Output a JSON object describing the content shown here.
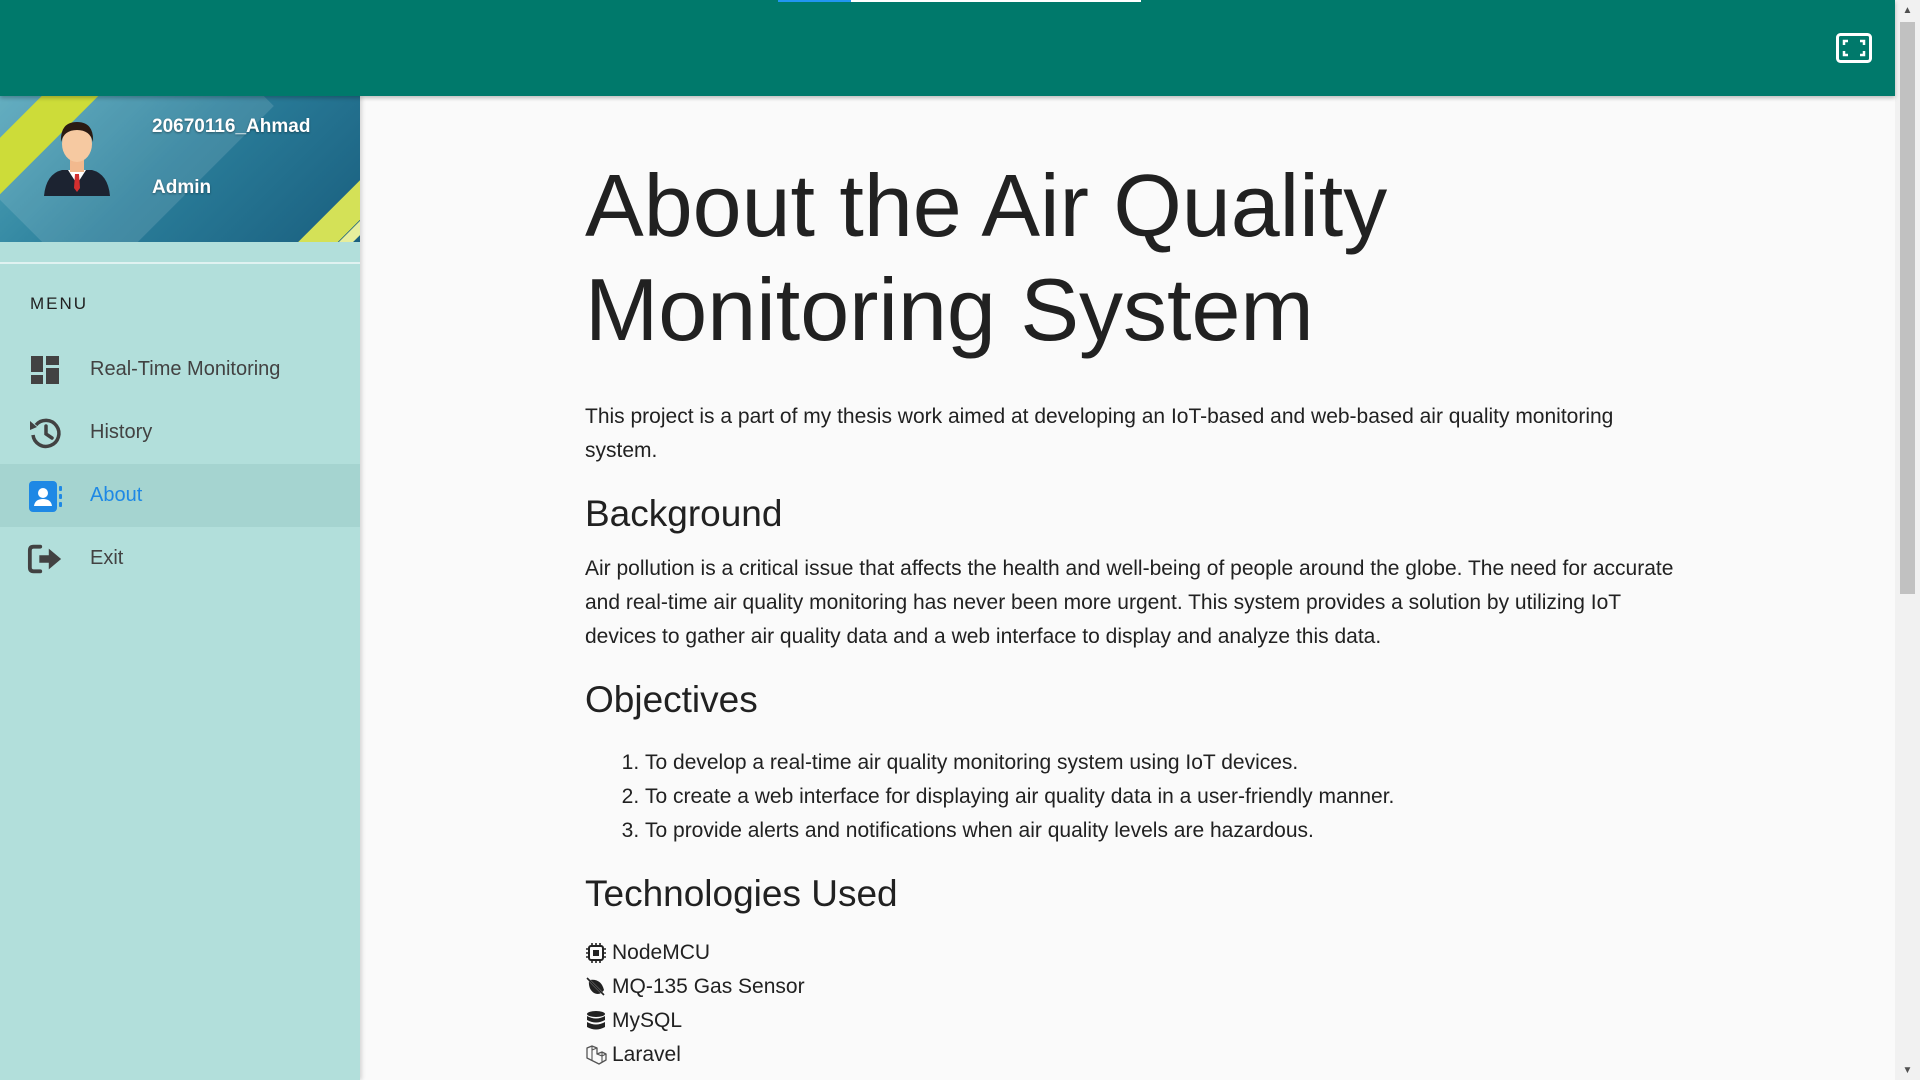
{
  "colors": {
    "topbar": "#00796b",
    "sidebar": "#b2dfdb",
    "active_item_bg": "#a5d4d0",
    "active_item_text": "#1e88e5",
    "content_bg": "#fafafa"
  },
  "topbar": {
    "fullscreen_icon": "fullscreen-icon"
  },
  "profile": {
    "username": "20670116_Ahmad",
    "role": "Admin"
  },
  "sidebar": {
    "heading": "MENU",
    "items": [
      {
        "label": "Real-Time Monitoring",
        "icon": "dashboard-icon",
        "active": false
      },
      {
        "label": "History",
        "icon": "history-icon",
        "active": false
      },
      {
        "label": "About",
        "icon": "contact-card-icon",
        "active": true
      },
      {
        "label": "Exit",
        "icon": "exit-icon",
        "active": false
      }
    ]
  },
  "main": {
    "title_line1": "About the Air Quality",
    "title_line2": "Monitoring System",
    "intro": "This project is a part of my thesis work aimed at developing an IoT-based and web-based air quality monitoring system.",
    "background_heading": "Background",
    "background_text": "Air pollution is a critical issue that affects the health and well-being of people around the globe. The need for accurate and real-time air quality monitoring has never been more urgent. This system provides a solution by utilizing IoT devices to gather air quality data and a web interface to display and analyze this data.",
    "objectives_heading": "Objectives",
    "objectives": [
      "To develop a real-time air quality monitoring system using IoT devices.",
      "To create a web interface for displaying air quality data in a user-friendly manner.",
      "To provide alerts and notifications when air quality levels are hazardous."
    ],
    "technologies_heading": "Technologies Used",
    "technologies": [
      {
        "label": "NodeMCU",
        "icon": "microchip-icon"
      },
      {
        "label": "MQ-135 Gas Sensor",
        "icon": "leaf-slash-icon"
      },
      {
        "label": "MySQL",
        "icon": "database-icon"
      },
      {
        "label": "Laravel",
        "icon": "laravel-icon"
      }
    ]
  },
  "scrollbar": {
    "position": 0
  }
}
